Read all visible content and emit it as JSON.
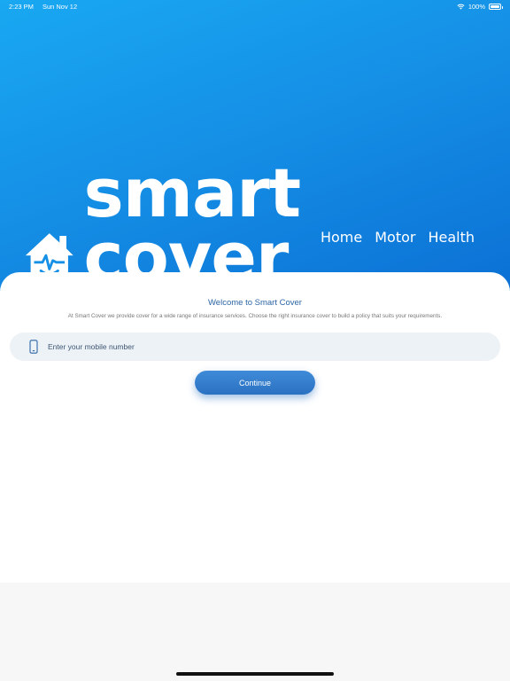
{
  "status_bar": {
    "time": "2:23 PM",
    "date": "Sun Nov 12",
    "battery": "100%"
  },
  "brand": {
    "name": "smart cover",
    "tagline": [
      "Home",
      "Motor",
      "Health"
    ],
    "primary_color": "#1590e6"
  },
  "welcome": {
    "title": "Welcome to Smart Cover",
    "description": "At Smart Cover we provide cover for a wide range of insurance services. Choose the right insurance cover to build a policy that suits your requirements."
  },
  "mobile_input": {
    "placeholder": "Enter your mobile number",
    "value": "",
    "icon": "phone-icon"
  },
  "continue_button": {
    "label": "Continue"
  }
}
